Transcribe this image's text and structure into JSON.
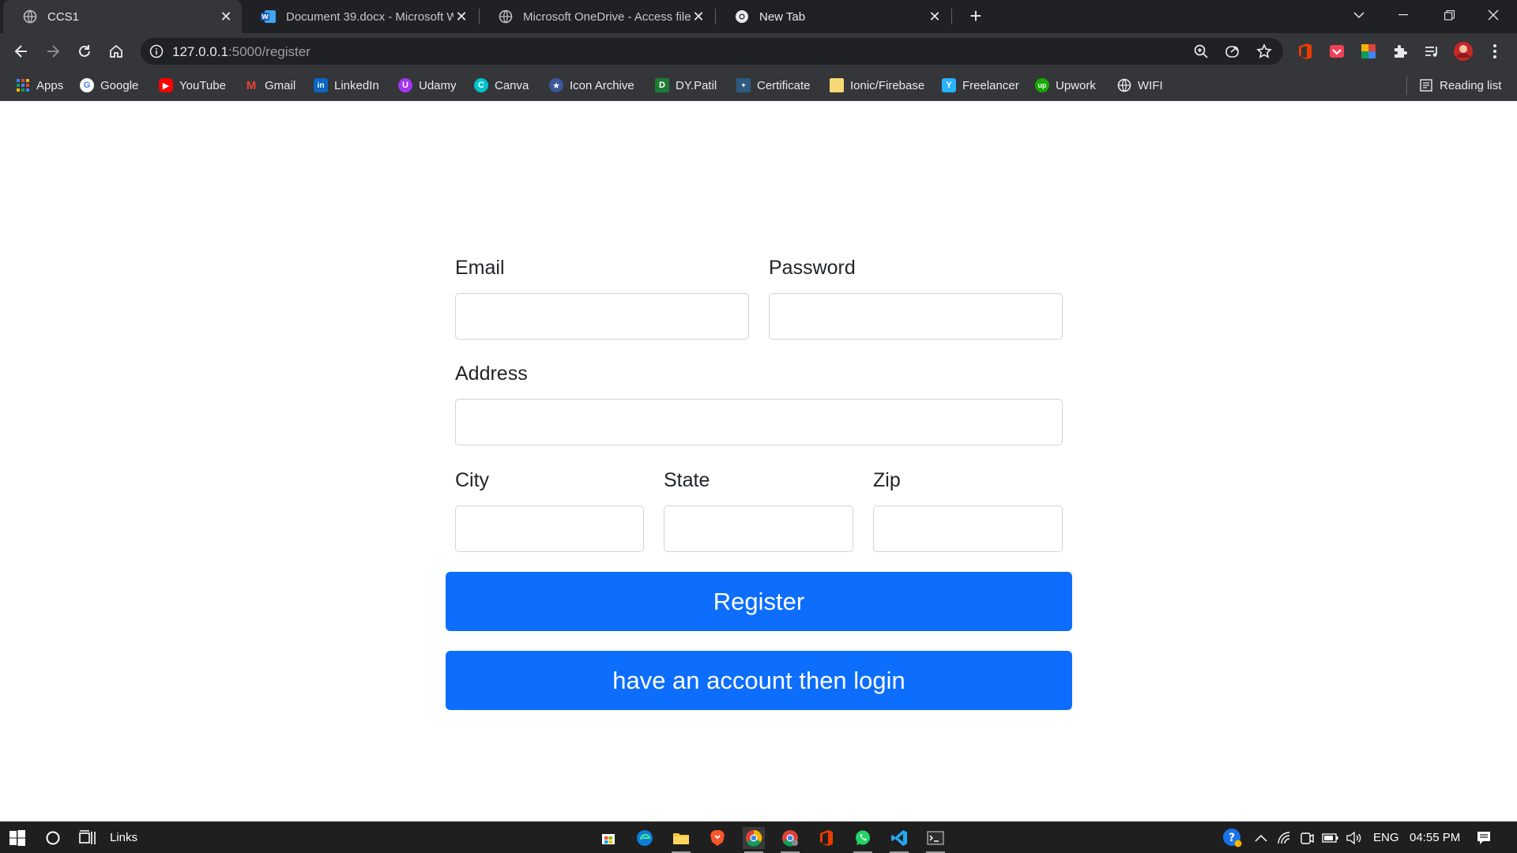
{
  "browser": {
    "tabs": [
      {
        "title": "CCS1",
        "favicon": "globe-icon",
        "active": true
      },
      {
        "title": "Document 39.docx - Microsoft W",
        "favicon": "word-icon",
        "active": false
      },
      {
        "title": "Microsoft OneDrive - Access files",
        "favicon": "globe-icon",
        "active": false
      },
      {
        "title": "New Tab",
        "favicon": "chrome-icon",
        "active": false
      }
    ],
    "address": {
      "host": "127.0.0.1",
      "path": ":5000/register"
    },
    "bookmarks": [
      {
        "label": "Apps",
        "icon": "apps-grid-icon"
      },
      {
        "label": "Google",
        "icon": "google-icon"
      },
      {
        "label": "YouTube",
        "icon": "youtube-icon"
      },
      {
        "label": "Gmail",
        "icon": "gmail-icon"
      },
      {
        "label": "LinkedIn",
        "icon": "linkedin-icon"
      },
      {
        "label": "Udamy",
        "icon": "udemy-icon"
      },
      {
        "label": "Canva",
        "icon": "canva-icon"
      },
      {
        "label": "Icon Archive",
        "icon": "icon-archive-icon"
      },
      {
        "label": "DY.Patil",
        "icon": "dypatil-icon"
      },
      {
        "label": "Certificate",
        "icon": "certificate-icon"
      },
      {
        "label": "Ionic/Firebase",
        "icon": "folder-icon"
      },
      {
        "label": "Freelancer",
        "icon": "freelancer-icon"
      },
      {
        "label": "Upwork",
        "icon": "upwork-icon"
      },
      {
        "label": "WIFI",
        "icon": "globe-icon"
      }
    ],
    "reading_list": "Reading list"
  },
  "form": {
    "email_label": "Email",
    "password_label": "Password",
    "address_label": "Address",
    "city_label": "City",
    "state_label": "State",
    "zip_label": "Zip",
    "register_button": "Register",
    "login_button": "have an account then login"
  },
  "taskbar": {
    "links_label": "Links",
    "language": "ENG",
    "time": "04:55 PM"
  },
  "colors": {
    "primary": "#0d6efd",
    "chrome_dark": "#202124",
    "chrome_toolbar": "#35363a"
  }
}
